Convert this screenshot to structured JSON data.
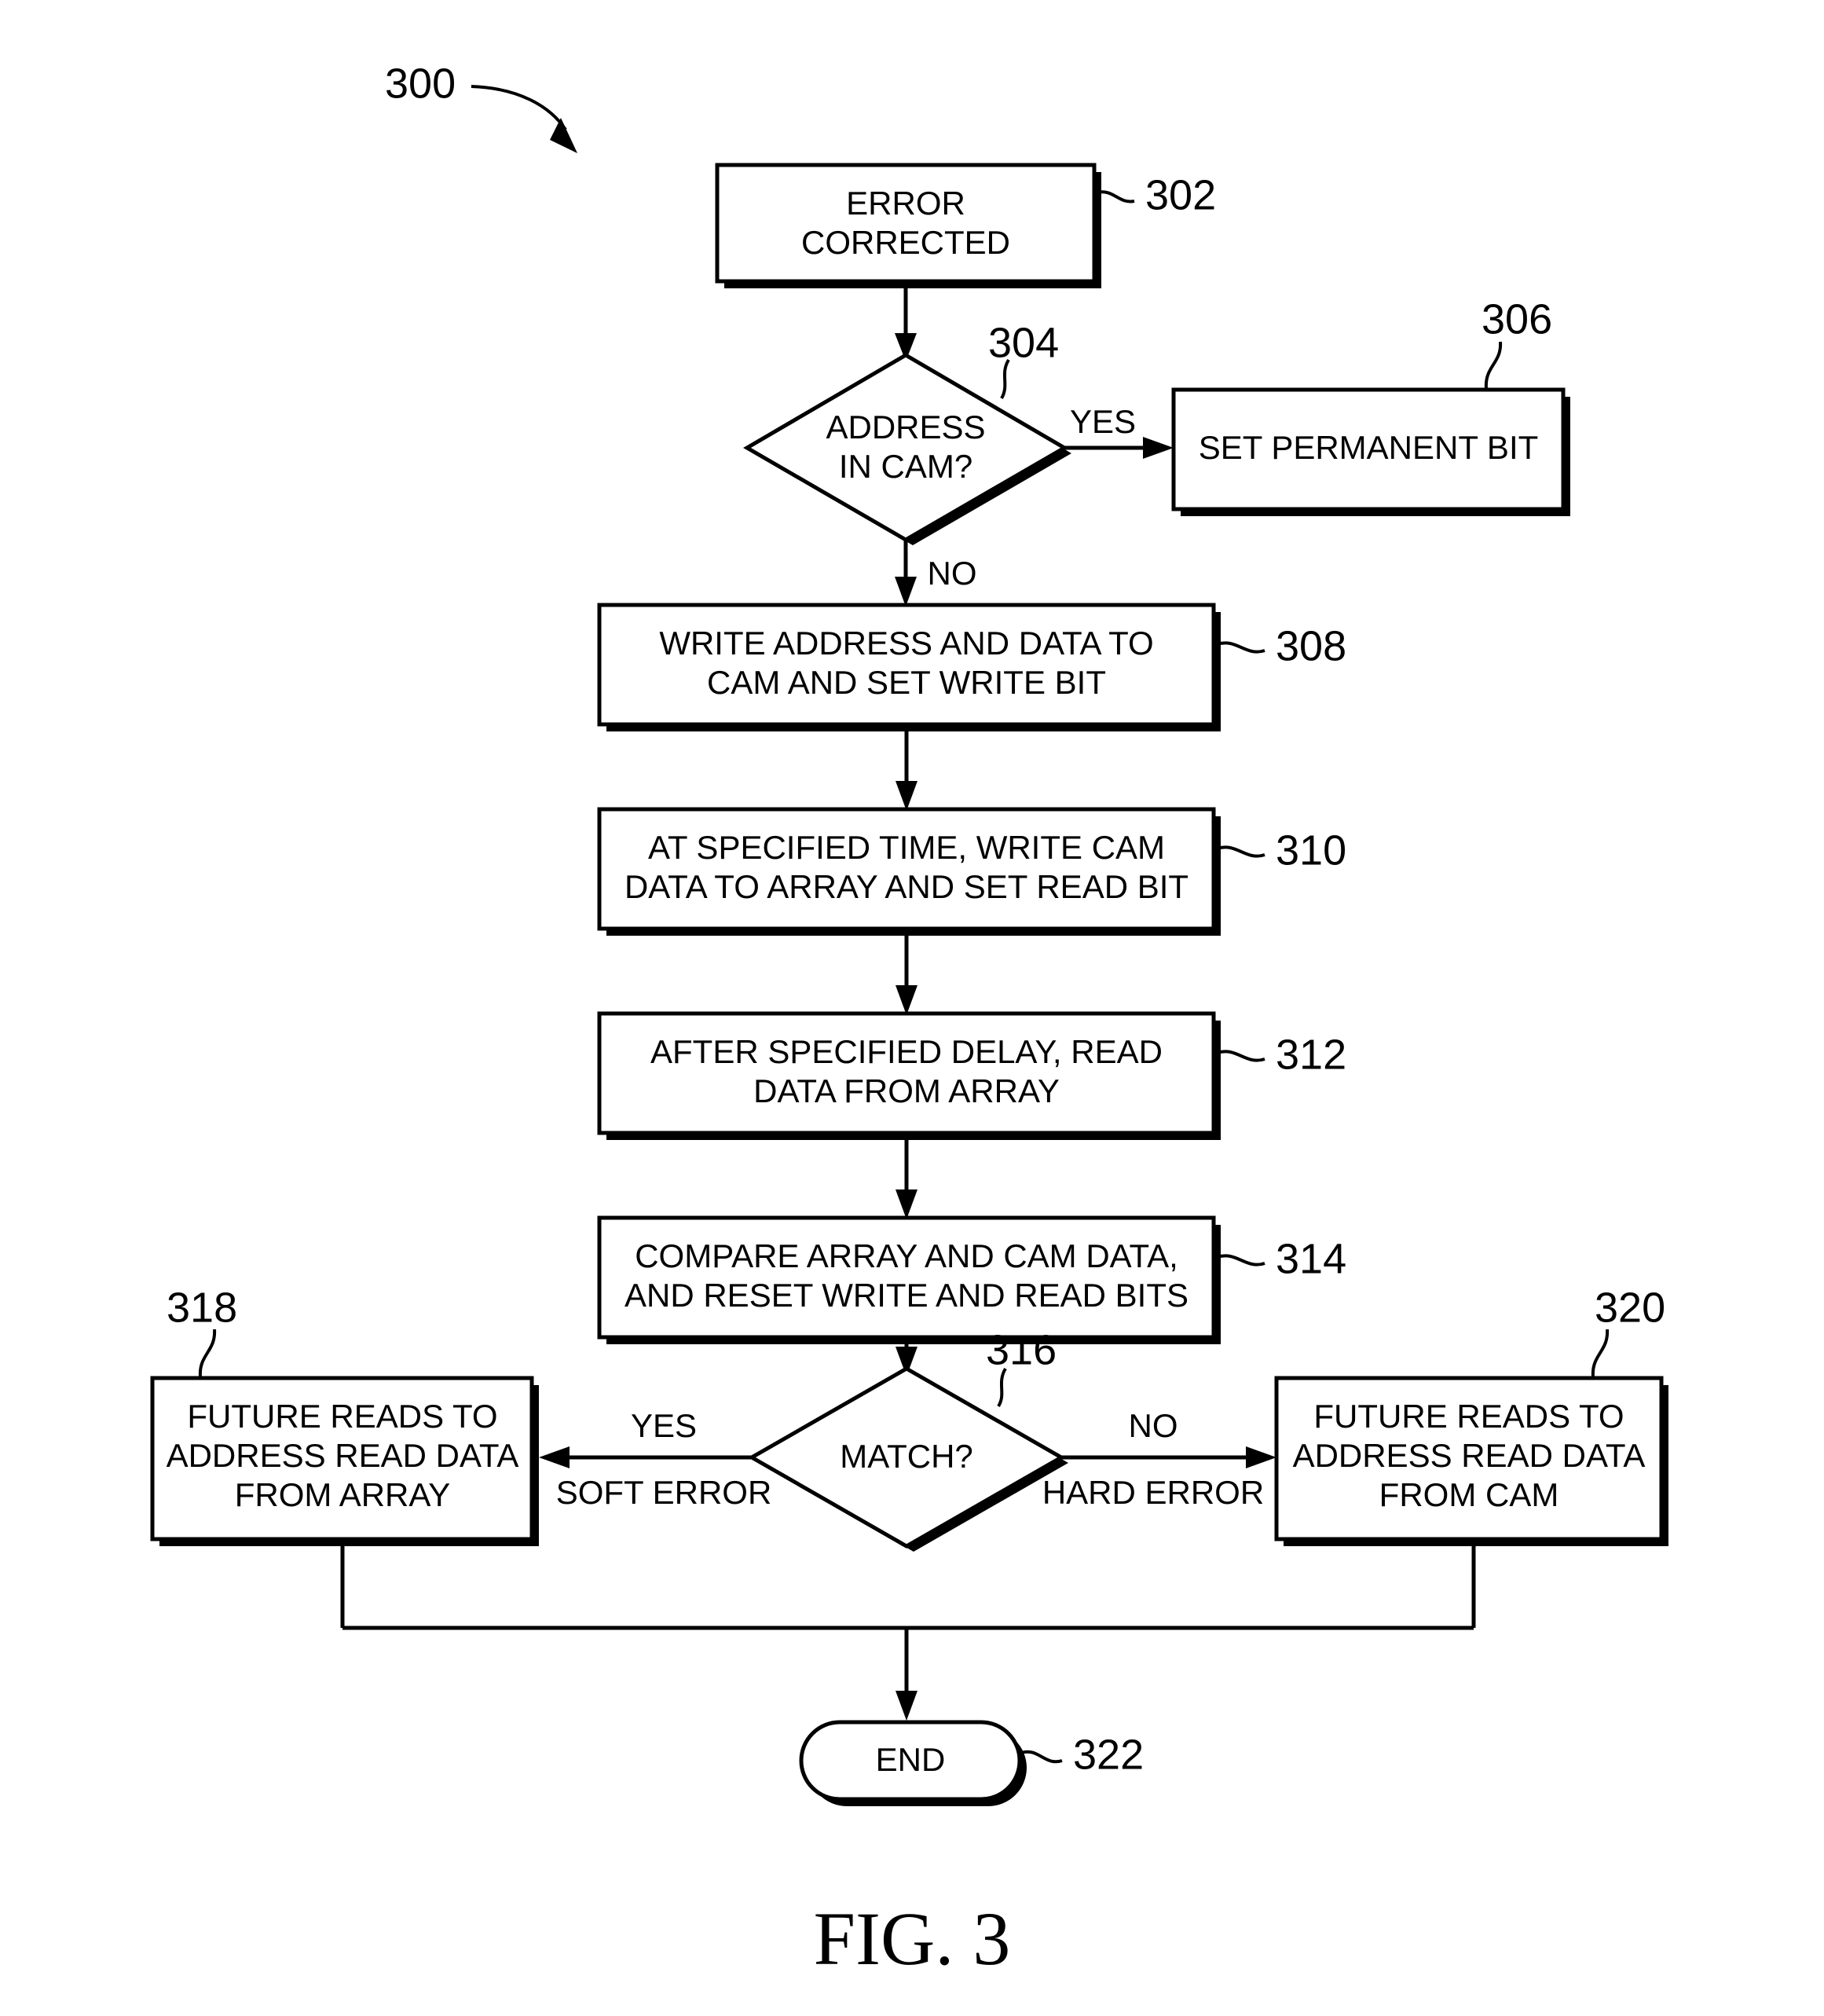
{
  "figure": {
    "caption": "FIG. 3",
    "diagram_ref": "300",
    "type": "flowchart"
  },
  "nodes": {
    "n302": {
      "ref": "302",
      "shape": "process",
      "line1": "ERROR",
      "line2": "CORRECTED"
    },
    "n304": {
      "ref": "304",
      "shape": "decision",
      "line1": "ADDRESS",
      "line2": "IN CAM?"
    },
    "n306": {
      "ref": "306",
      "shape": "process",
      "line1": "SET PERMANENT BIT",
      "line2": ""
    },
    "n308": {
      "ref": "308",
      "shape": "process",
      "line1": "WRITE ADDRESS AND DATA TO",
      "line2": "CAM AND SET WRITE BIT"
    },
    "n310": {
      "ref": "310",
      "shape": "process",
      "line1": "AT SPECIFIED TIME, WRITE CAM",
      "line2": "DATA TO ARRAY AND SET READ BIT"
    },
    "n312": {
      "ref": "312",
      "shape": "process",
      "line1": "AFTER SPECIFIED DELAY, READ",
      "line2": "DATA FROM ARRAY"
    },
    "n314": {
      "ref": "314",
      "shape": "process",
      "line1": "COMPARE ARRAY AND CAM DATA,",
      "line2": "AND RESET WRITE AND READ BITS"
    },
    "n316": {
      "ref": "316",
      "shape": "decision",
      "line1": "MATCH?",
      "line2": ""
    },
    "n318": {
      "ref": "318",
      "shape": "process",
      "line1": "FUTURE READS TO",
      "line2": "ADDRESS READ DATA",
      "line3": "FROM ARRAY"
    },
    "n320": {
      "ref": "320",
      "shape": "process",
      "line1": "FUTURE READS TO",
      "line2": "ADDRESS READ DATA",
      "line3": "FROM CAM"
    },
    "n322": {
      "ref": "322",
      "shape": "terminator",
      "line1": "END",
      "line2": ""
    }
  },
  "edges": {
    "e304_yes": "YES",
    "e304_no": "NO",
    "e316_yes": "YES",
    "e316_yes_sub": "SOFT ERROR",
    "e316_no": "NO",
    "e316_no_sub": "HARD ERROR"
  },
  "colors": {
    "stroke": "#000000",
    "fill": "#ffffff",
    "background": "#ffffff"
  }
}
